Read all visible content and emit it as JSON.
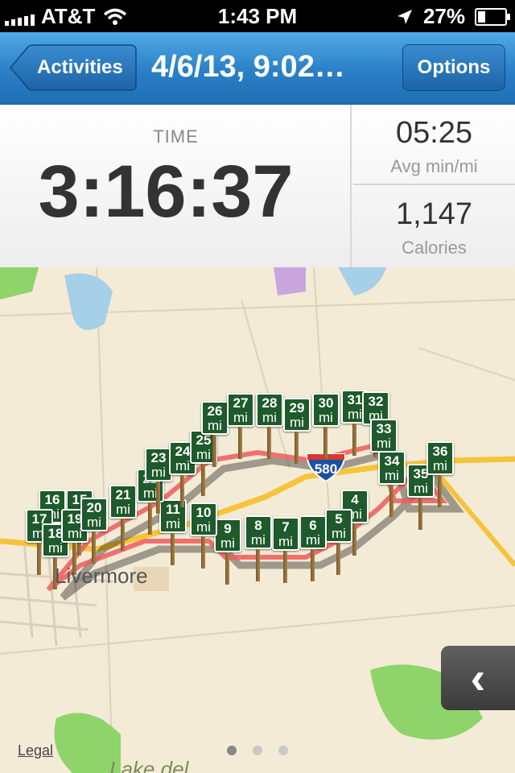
{
  "status_bar": {
    "carrier": "AT&T",
    "time": "1:43 PM",
    "battery": "27%",
    "battery_level": 0.27
  },
  "nav": {
    "back_label": "Activities",
    "title": "4/6/13, 9:02…",
    "options_label": "Options"
  },
  "stats": {
    "time_label": "TIME",
    "time_value": "3:16:37",
    "pace_value": "05:25",
    "pace_label": "Avg min/mi",
    "calories_value": "1,147",
    "calories_label": "Calories"
  },
  "map": {
    "highway_label": "580",
    "town_label": "Livermore",
    "bottom_label": "Lake del",
    "legal_label": "Legal",
    "pager": {
      "count": 3,
      "active": 0
    },
    "side_button_icon": "chevron-left-icon",
    "mile_unit": "mi",
    "mile_markers": [
      "4",
      "5",
      "6",
      "7",
      "8",
      "9",
      "10",
      "11",
      "15",
      "16",
      "17",
      "18",
      "19",
      "20",
      "21",
      "22",
      "23",
      "24",
      "25",
      "26",
      "27",
      "28",
      "29",
      "30",
      "31",
      "32",
      "33",
      "34",
      "35",
      "36"
    ]
  },
  "colors": {
    "nav_blue": "#2a7fc6",
    "route_red": "#ee5a5a",
    "marker_green": "#1e5a2b",
    "map_background": "#f3ebd6"
  }
}
